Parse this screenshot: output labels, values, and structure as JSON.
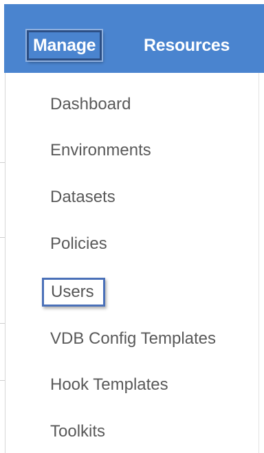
{
  "header": {
    "tabs": [
      {
        "label": "Manage"
      },
      {
        "label": "Resources"
      }
    ]
  },
  "menu": {
    "items": [
      {
        "label": "Dashboard"
      },
      {
        "label": "Environments"
      },
      {
        "label": "Datasets"
      },
      {
        "label": "Policies"
      },
      {
        "label": "Users"
      },
      {
        "label": "VDB Config Templates"
      },
      {
        "label": "Hook Templates"
      },
      {
        "label": "Toolkits"
      }
    ]
  },
  "colors": {
    "header_bg": "#4a84cf",
    "highlight_border": "#4a70b8",
    "menu_text": "#595959"
  }
}
